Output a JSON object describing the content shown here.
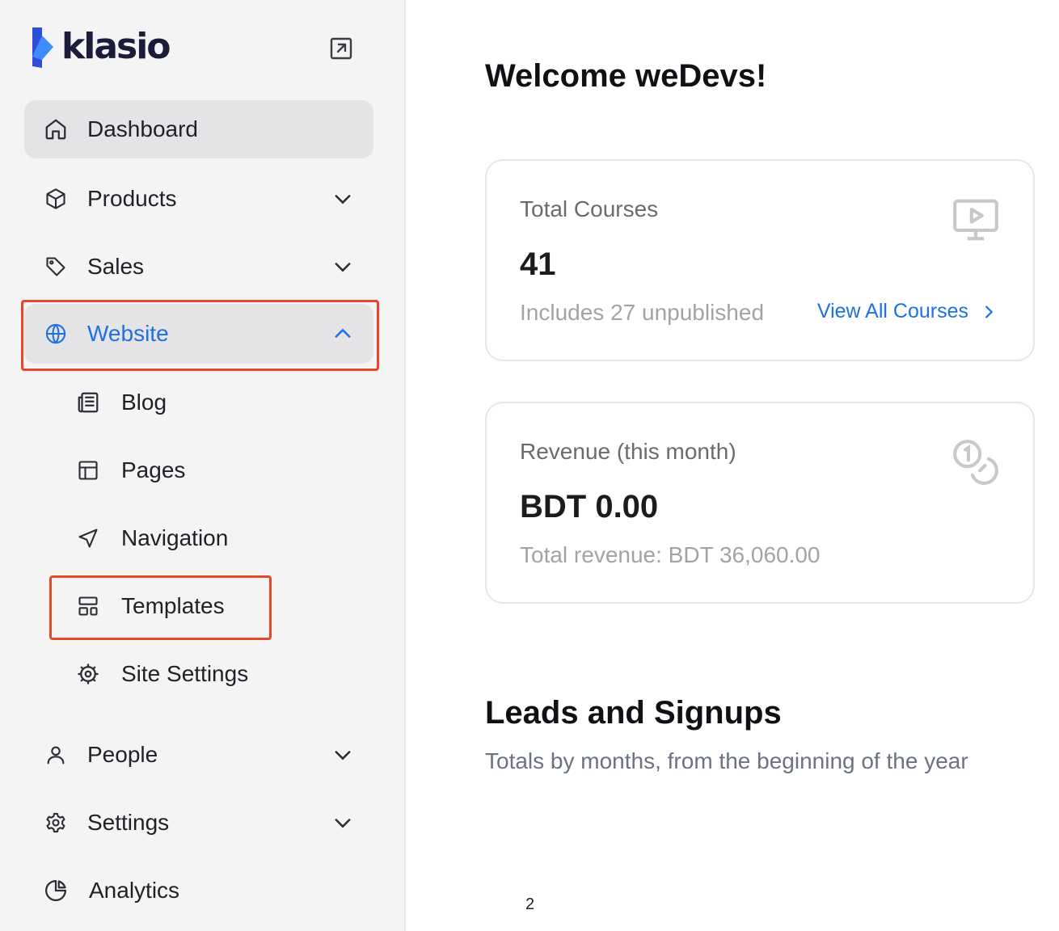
{
  "brand": {
    "name": "klasio",
    "accent": "#1f6fe5",
    "highlight": "#e5472d"
  },
  "sidebar": {
    "collapse_icon": "expand-arrow-icon",
    "items": [
      {
        "id": "dashboard",
        "label": "Dashboard",
        "icon": "home-icon",
        "active": true
      },
      {
        "id": "products",
        "label": "Products",
        "icon": "box-icon",
        "chevron": "down"
      },
      {
        "id": "sales",
        "label": "Sales",
        "icon": "tag-icon",
        "chevron": "down"
      },
      {
        "id": "website",
        "label": "Website",
        "icon": "globe-icon",
        "chevron": "up",
        "expanded": true,
        "children": [
          {
            "id": "blog",
            "label": "Blog",
            "icon": "newspaper-icon"
          },
          {
            "id": "pages",
            "label": "Pages",
            "icon": "layout-icon"
          },
          {
            "id": "navigation",
            "label": "Navigation",
            "icon": "navigation-icon"
          },
          {
            "id": "templates",
            "label": "Templates",
            "icon": "template-icon"
          },
          {
            "id": "site-settings",
            "label": "Site Settings",
            "icon": "cog-icon"
          }
        ]
      },
      {
        "id": "people",
        "label": "People",
        "icon": "user-icon",
        "chevron": "down"
      },
      {
        "id": "settings",
        "label": "Settings",
        "icon": "gear-icon",
        "chevron": "down"
      },
      {
        "id": "analytics",
        "label": "Analytics",
        "icon": "pie-chart-icon"
      }
    ]
  },
  "main": {
    "welcome": "Welcome weDevs!",
    "cards": [
      {
        "title": "Total Courses",
        "value": "41",
        "sub": "Includes 27 unpublished",
        "link": "View All Courses",
        "icon": "video-screen-icon"
      },
      {
        "title": "Revenue (this month)",
        "value": "BDT 0.00",
        "sub": "Total revenue: BDT 36,060.00",
        "icon": "coins-icon"
      }
    ],
    "leads": {
      "title": "Leads and Signups",
      "subtitle": "Totals by months, from the beginning of the year"
    },
    "page_number": "2"
  }
}
